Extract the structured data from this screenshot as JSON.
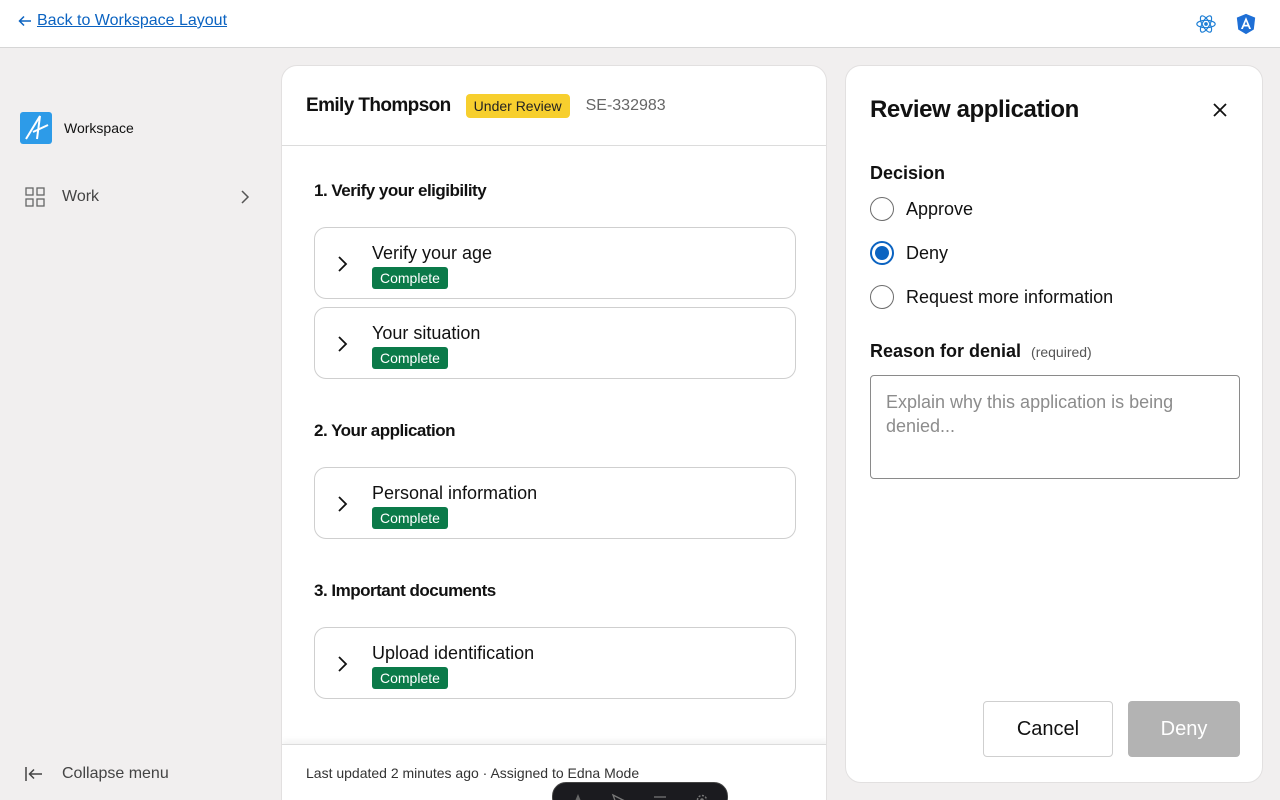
{
  "topbar": {
    "back_link": "Back to Workspace Layout",
    "icons": [
      "react-icon",
      "angular-icon"
    ]
  },
  "sidebar": {
    "brand": "Workspace",
    "nav_work": "Work",
    "collapse": "Collapse menu"
  },
  "applicant": {
    "name": "Emily Thompson",
    "status": "Under Review",
    "case_id": "SE-332983"
  },
  "sections": [
    {
      "title": "1. Verify your eligibility",
      "tasks": [
        {
          "title": "Verify your age",
          "status": "Complete"
        },
        {
          "title": "Your situation",
          "status": "Complete"
        }
      ]
    },
    {
      "title": "2. Your application",
      "tasks": [
        {
          "title": "Personal information",
          "status": "Complete"
        }
      ]
    },
    {
      "title": "3. Important documents",
      "tasks": [
        {
          "title": "Upload identification",
          "status": "Complete"
        }
      ]
    }
  ],
  "footer": {
    "text": "Last updated 2 minutes ago · Assigned to Edna Mode"
  },
  "review": {
    "title": "Review application",
    "decision_label": "Decision",
    "options": [
      {
        "label": "Approve",
        "selected": false
      },
      {
        "label": "Deny",
        "selected": true
      },
      {
        "label": "Request more information",
        "selected": false
      }
    ],
    "reason_label": "Reason for denial",
    "reason_required": "(required)",
    "reason_placeholder": "Explain why this application is being denied...",
    "cancel_label": "Cancel",
    "submit_label": "Deny"
  },
  "colors": {
    "link": "#0b63c1",
    "status_under_review": "#f7cf2e",
    "status_complete": "#0b7a49",
    "radio_selected": "#0b63c1",
    "button_disabled": "#b3b3b3"
  }
}
